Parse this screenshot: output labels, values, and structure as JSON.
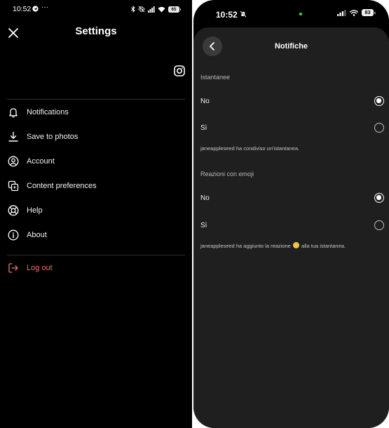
{
  "android": {
    "status": {
      "time": "10:52",
      "more_icon": "···",
      "battery": "65"
    },
    "header": {
      "title": "Settings"
    },
    "menu": [
      {
        "label": "Notifications",
        "icon": "bell-icon"
      },
      {
        "label": "Save to photos",
        "icon": "download-icon"
      },
      {
        "label": "Account",
        "icon": "account-icon"
      },
      {
        "label": "Content preferences",
        "icon": "content-preferences-icon"
      },
      {
        "label": "Help",
        "icon": "lifebuoy-icon"
      },
      {
        "label": "About",
        "icon": "info-icon"
      }
    ],
    "logout": {
      "label": "Log out",
      "icon": "logout-icon",
      "color": "#f0707a"
    }
  },
  "ios": {
    "status": {
      "time": "10:52",
      "battery": "83"
    },
    "header": {
      "title": "Notifiche"
    },
    "sections": [
      {
        "label": "Istantanee",
        "options": [
          {
            "label": "No",
            "selected": true
          },
          {
            "label": "Sì",
            "selected": false
          }
        ],
        "preview": "janeappleseed ha condiviso un'istantanea."
      },
      {
        "label": "Reazioni con emoji",
        "options": [
          {
            "label": "No",
            "selected": true
          },
          {
            "label": "Sì",
            "selected": false
          }
        ],
        "preview_before": "janeappleseed ha aggiunto la reazione",
        "preview_after": "alla tua istantanea."
      }
    ]
  }
}
